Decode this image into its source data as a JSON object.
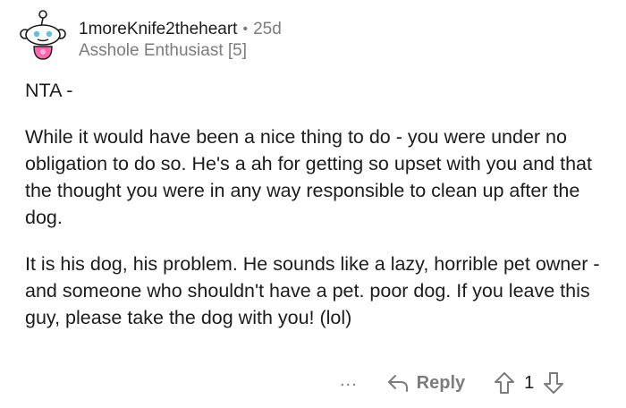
{
  "comment": {
    "author": "1moreKnife2theheart",
    "separator": "•",
    "age": "25d",
    "flair": "Asshole Enthusiast [5]",
    "paragraphs": [
      "NTA -",
      "While it would have been a nice thing to do - you were under no obligation to do so. He's a ah for getting so upset with you and that the thought you were in any way responsible to clean up after the dog.",
      "It is his dog, his problem.  He sounds like a lazy, horrible pet owner - and someone who shouldn't have a pet. poor dog.  If you leave this guy, please take the dog with you! (lol)"
    ],
    "actions": {
      "more_label": "...",
      "reply_label": "Reply",
      "score": "1"
    }
  },
  "icons": {
    "avatar": "snoo-avatar-icon",
    "reply": "reply-arrow-icon",
    "upvote": "upvote-arrow-icon",
    "downvote": "downvote-arrow-icon"
  },
  "colors": {
    "text": "#1c1c1c",
    "muted": "#7c7c7c",
    "avatar_accent": "#ff66ac"
  }
}
